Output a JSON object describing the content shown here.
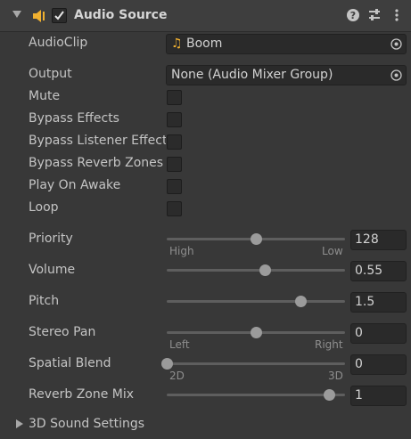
{
  "header": {
    "title": "Audio Source",
    "enabled": true
  },
  "audio_clip": {
    "label": "AudioClip",
    "value": "Boom"
  },
  "output": {
    "label": "Output",
    "value": "None (Audio Mixer Group)"
  },
  "toggles": {
    "mute": {
      "label": "Mute",
      "checked": false
    },
    "bypass_effects": {
      "label": "Bypass Effects",
      "checked": false
    },
    "bypass_listener": {
      "label": "Bypass Listener Effects",
      "checked": false
    },
    "bypass_reverb": {
      "label": "Bypass Reverb Zones",
      "checked": false
    },
    "play_on_awake": {
      "label": "Play On Awake",
      "checked": false
    },
    "loop": {
      "label": "Loop",
      "checked": false
    }
  },
  "sliders": {
    "priority": {
      "label": "Priority",
      "value": "128",
      "min": 0,
      "max": 256,
      "left_label": "High",
      "right_label": "Low"
    },
    "volume": {
      "label": "Volume",
      "value": "0.55",
      "min": 0,
      "max": 1
    },
    "pitch": {
      "label": "Pitch",
      "value": "1.5",
      "min": -3,
      "max": 3
    },
    "stereo_pan": {
      "label": "Stereo Pan",
      "value": "0",
      "min": -1,
      "max": 1,
      "left_label": "Left",
      "right_label": "Right"
    },
    "spatial_blend": {
      "label": "Spatial Blend",
      "value": "0",
      "min": 0,
      "max": 1,
      "left_label": "2D",
      "right_label": "3D"
    },
    "reverb_zone_mix": {
      "label": "Reverb Zone Mix",
      "value": "1",
      "min": 0,
      "max": 1.1
    }
  },
  "sound_settings": {
    "label": "3D Sound Settings"
  }
}
